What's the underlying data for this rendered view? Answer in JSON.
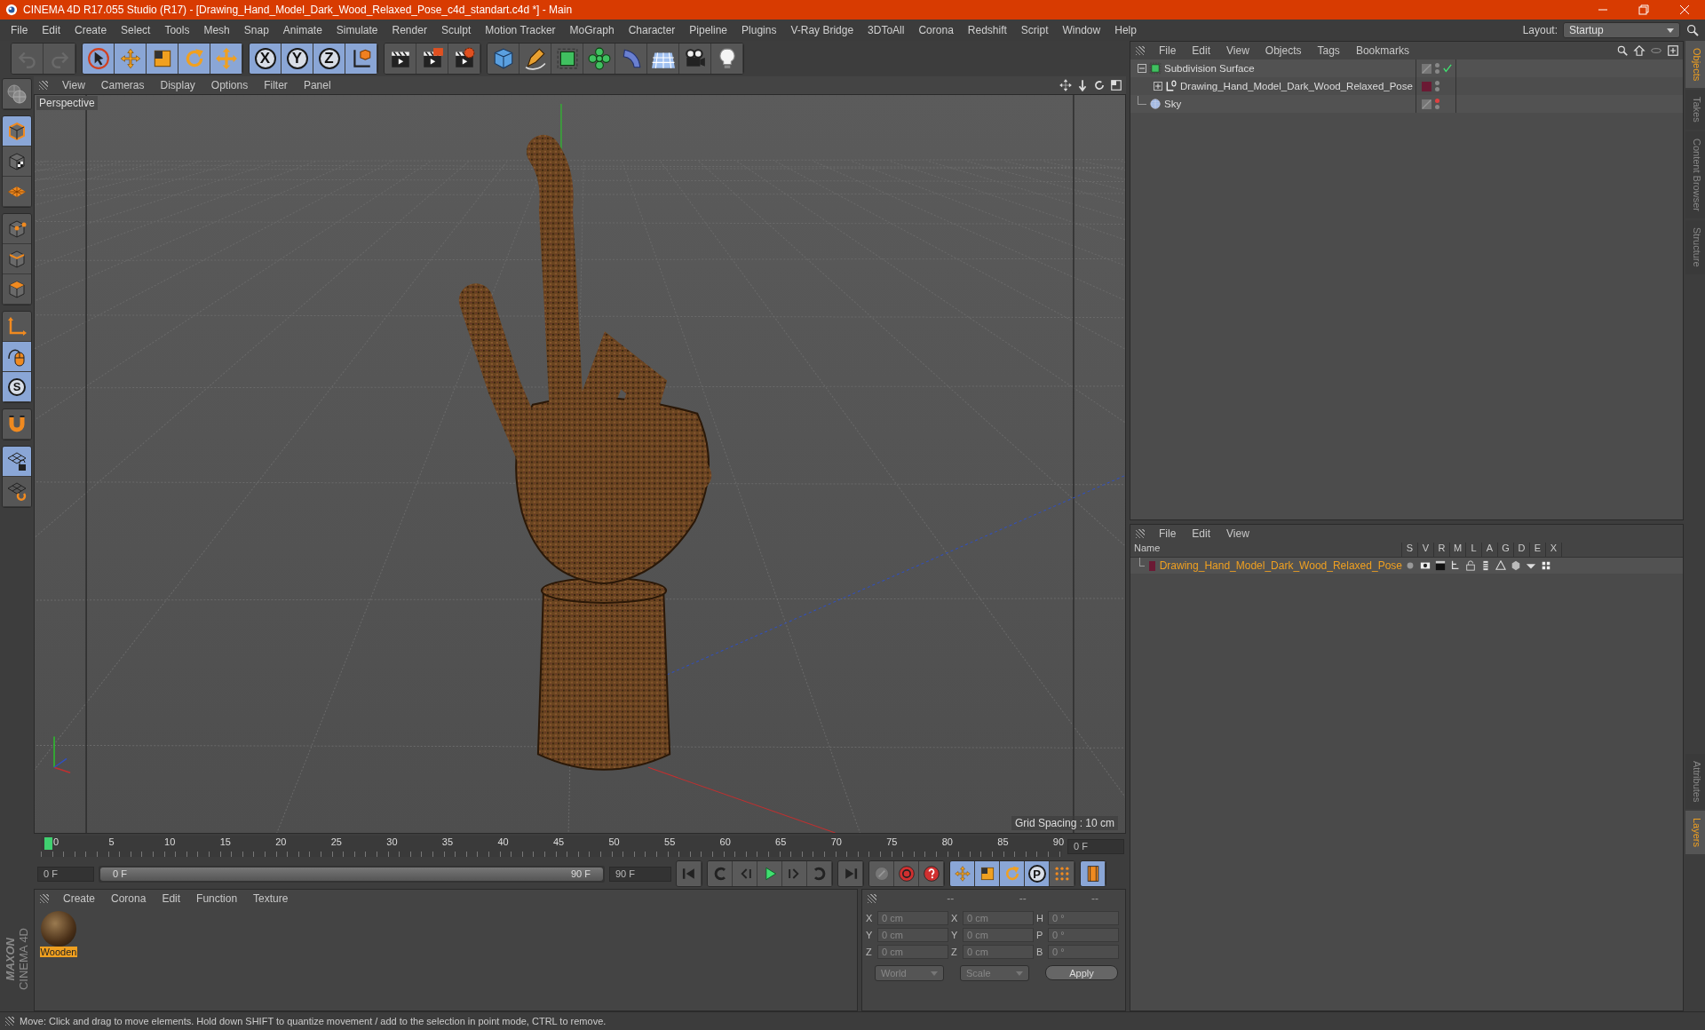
{
  "window": {
    "title": "CINEMA 4D R17.055 Studio (R17) - [Drawing_Hand_Model_Dark_Wood_Relaxed_Pose_c4d_standart.c4d *] - Main"
  },
  "menu": [
    "File",
    "Edit",
    "Create",
    "Select",
    "Tools",
    "Mesh",
    "Snap",
    "Animate",
    "Simulate",
    "Render",
    "Sculpt",
    "Motion Tracker",
    "MoGraph",
    "Character",
    "Pipeline",
    "Plugins",
    "V-Ray Bridge",
    "3DToAll",
    "Corona",
    "Redshift",
    "Script",
    "Window",
    "Help"
  ],
  "layout": {
    "label": "Layout:",
    "value": "Startup"
  },
  "toolbar": [
    [
      {
        "kind": "undo",
        "active": false
      },
      {
        "kind": "redo",
        "active": false
      }
    ],
    [
      {
        "kind": "cursor",
        "active": true
      },
      {
        "kind": "move",
        "active": true
      },
      {
        "kind": "scale",
        "active": true
      },
      {
        "kind": "rotate",
        "active": true
      },
      {
        "kind": "transform",
        "active": true
      }
    ],
    [
      {
        "kind": "letter",
        "label": "X",
        "active": true
      },
      {
        "kind": "letter",
        "label": "Y",
        "active": true
      },
      {
        "kind": "letter",
        "label": "Z",
        "active": true
      },
      {
        "kind": "axis-cube",
        "active": true
      }
    ],
    [
      {
        "kind": "clapperboard",
        "active": false
      },
      {
        "kind": "clapperboard-red",
        "active": false
      },
      {
        "kind": "clapperboard-gear",
        "active": false
      }
    ],
    [
      {
        "kind": "cube",
        "active": false
      },
      {
        "kind": "pen",
        "active": false
      },
      {
        "kind": "cage-cube",
        "active": false
      },
      {
        "kind": "flower",
        "active": false
      },
      {
        "kind": "bend",
        "active": false
      },
      {
        "kind": "floor-grid",
        "active": false
      },
      {
        "kind": "camera",
        "active": false
      },
      {
        "kind": "light-bulb",
        "active": false
      }
    ]
  ],
  "left_tools": [
    [
      {
        "kind": "globe",
        "active": false
      }
    ],
    [
      {
        "kind": "model-cube",
        "active": true
      },
      {
        "kind": "texture-cube",
        "active": false
      },
      {
        "kind": "grid-plane",
        "active": false
      }
    ],
    [
      {
        "kind": "points-cube",
        "active": false
      },
      {
        "kind": "edges-cube",
        "active": false
      },
      {
        "kind": "polygons-cube",
        "active": false
      }
    ],
    [
      {
        "kind": "axis",
        "active": false
      },
      {
        "kind": "mouse",
        "active": true
      },
      {
        "kind": "letter",
        "label": "S",
        "active": true
      }
    ],
    [
      {
        "kind": "magnet",
        "active": false
      }
    ],
    [
      {
        "kind": "lock-grid",
        "active": true
      },
      {
        "kind": "rotate-grid",
        "active": false
      }
    ]
  ],
  "viewport": {
    "menu": [
      "View",
      "Cameras",
      "Display",
      "Options",
      "Filter",
      "Panel"
    ],
    "camera": "Perspective",
    "grid_spacing": "Grid Spacing : 10 cm"
  },
  "timeline": {
    "ticks": [
      "0",
      "5",
      "10",
      "15",
      "20",
      "25",
      "30",
      "35",
      "40",
      "45",
      "50",
      "55",
      "60",
      "65",
      "70",
      "75",
      "80",
      "85",
      "90"
    ],
    "current_frame": "0 F",
    "start": "0 F",
    "range": {
      "start": "0 F",
      "end": "90 F",
      "level": 1
    },
    "end": "90 F"
  },
  "playback": [
    [
      {
        "kind": "skip-start",
        "active": false
      }
    ],
    [
      {
        "kind": "rewind",
        "active": false
      },
      {
        "kind": "step-back",
        "active": false
      },
      {
        "kind": "play",
        "active": false
      },
      {
        "kind": "step-forward",
        "active": false
      },
      {
        "kind": "loop",
        "active": false
      }
    ],
    [
      {
        "kind": "skip-end",
        "active": false
      }
    ],
    [
      {
        "kind": "key-off",
        "active": false
      },
      {
        "kind": "record",
        "active": false
      },
      {
        "kind": "help-circle",
        "active": false
      }
    ],
    [
      {
        "kind": "move",
        "active": true
      },
      {
        "kind": "scale",
        "active": true
      },
      {
        "kind": "rotate",
        "active": true
      },
      {
        "kind": "letter",
        "label": "P",
        "active": true
      },
      {
        "kind": "dots-grid",
        "active": false
      }
    ],
    [
      {
        "kind": "film-strip",
        "active": true
      }
    ]
  ],
  "materials": {
    "menu": [
      "Create",
      "Corona",
      "Edit",
      "Function",
      "Texture"
    ],
    "items": [
      {
        "name": "Wooden",
        "selected": true
      }
    ]
  },
  "coordinates": {
    "headers": [
      "--",
      "--",
      "--"
    ],
    "rows": [
      {
        "pos_label": "X",
        "position": "0 cm",
        "size_label": "X",
        "size": "0 cm",
        "rot_label": "H",
        "rotation": "0 °"
      },
      {
        "pos_label": "Y",
        "position": "0 cm",
        "size_label": "Y",
        "size": "0 cm",
        "rot_label": "P",
        "rotation": "0 °"
      },
      {
        "pos_label": "Z",
        "position": "0 cm",
        "size_label": "Z",
        "size": "0 cm",
        "rot_label": "B",
        "rotation": "0 °"
      }
    ],
    "space": "World",
    "mode": "Scale",
    "apply": "Apply"
  },
  "brand": {
    "maker": "MAXON",
    "product": "CINEMA 4D"
  },
  "objects": {
    "menu": [
      "File",
      "Edit",
      "View",
      "Objects",
      "Tags",
      "Bookmarks"
    ],
    "items": [
      {
        "name": "Subdivision Surface",
        "kind": "subdivision",
        "expanded": true,
        "enabled": true,
        "editor_visible": true,
        "children": [
          {
            "name": "Drawing_Hand_Model_Dark_Wood_Relaxed_Pose",
            "kind": "null",
            "expanded": false,
            "enabled": false,
            "editor_visible": true,
            "color": "#6b1a34"
          }
        ]
      },
      {
        "name": "Sky",
        "kind": "sky",
        "enabled": false,
        "editor_visible": false
      }
    ]
  },
  "layers": {
    "menu": [
      "File",
      "Edit",
      "View"
    ],
    "columns": [
      "Name",
      "S",
      "V",
      "R",
      "M",
      "L",
      "A",
      "G",
      "D",
      "E",
      "X"
    ],
    "rows": [
      {
        "name": "Drawing_Hand_Model_Dark_Wood_Relaxed_Pose",
        "color": "#6b1a34"
      }
    ]
  },
  "side_tabs_top": [
    {
      "label": "Objects",
      "selected": true
    },
    {
      "label": "Takes",
      "selected": false
    },
    {
      "label": "Content Browser",
      "selected": false
    },
    {
      "label": "Structure",
      "selected": false
    }
  ],
  "side_tabs_bottom": [
    {
      "label": "Attributes",
      "selected": false
    },
    {
      "label": "Layers",
      "selected": true
    }
  ],
  "status_bar": "Move: Click and drag to move elements. Hold down SHIFT to quantize movement / add to the selection in point mode, CTRL to remove."
}
